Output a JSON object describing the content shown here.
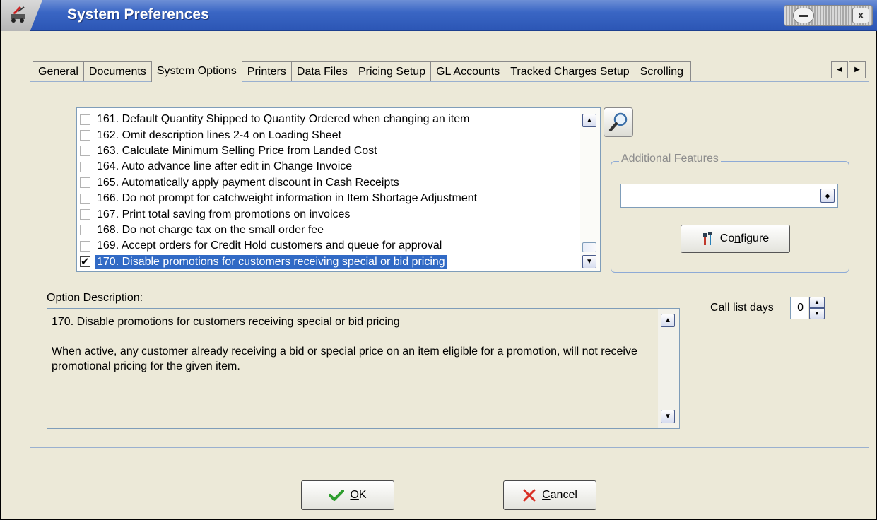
{
  "window": {
    "title": "System Preferences",
    "close_glyph": "x"
  },
  "tabs": [
    {
      "label": "General"
    },
    {
      "label": "Documents"
    },
    {
      "label": "System Options",
      "active": true
    },
    {
      "label": "Printers"
    },
    {
      "label": "Data Files"
    },
    {
      "label": "Pricing Setup"
    },
    {
      "label": "GL Accounts"
    },
    {
      "label": "Tracked Charges Setup"
    },
    {
      "label": "Scrolling"
    }
  ],
  "options": [
    {
      "label": "161. Default Quantity Shipped to Quantity Ordered when changing an item",
      "checked": false
    },
    {
      "label": "162. Omit description lines 2-4 on Loading Sheet",
      "checked": false
    },
    {
      "label": "163. Calculate Minimum Selling Price from Landed Cost",
      "checked": false
    },
    {
      "label": "164. Auto advance line after edit in Change Invoice",
      "checked": false
    },
    {
      "label": "165. Automatically apply payment discount in Cash Receipts",
      "checked": false
    },
    {
      "label": "166. Do not prompt for catchweight information in Item Shortage Adjustment",
      "checked": false
    },
    {
      "label": "167. Print total saving from promotions on invoices",
      "checked": false
    },
    {
      "label": "168. Do not charge tax on the small order fee",
      "checked": false
    },
    {
      "label": "169. Accept orders for Credit Hold customers and queue for approval",
      "checked": false
    },
    {
      "label": "170. Disable promotions for customers receiving special or bid pricing",
      "checked": true,
      "selected": true
    }
  ],
  "features": {
    "label": "Additional Features",
    "selected_value": "",
    "configure_pre": "Co",
    "configure_accel": "n",
    "configure_post": "figure"
  },
  "description": {
    "label": "Option Description:",
    "line1": "170. Disable promotions for customers receiving special or bid pricing",
    "line2": "When active, any customer already receiving a bid or special price on an item eligible for a promotion, will not receive promotional pricing for the given item."
  },
  "call_list": {
    "label": "Call list days",
    "value": "0"
  },
  "buttons": {
    "ok_accel": "O",
    "ok_rest": "K",
    "cancel_accel": "C",
    "cancel_rest": "ancel"
  },
  "colors": {
    "titlebar": "#2c56b5",
    "selection": "#316ac5"
  }
}
